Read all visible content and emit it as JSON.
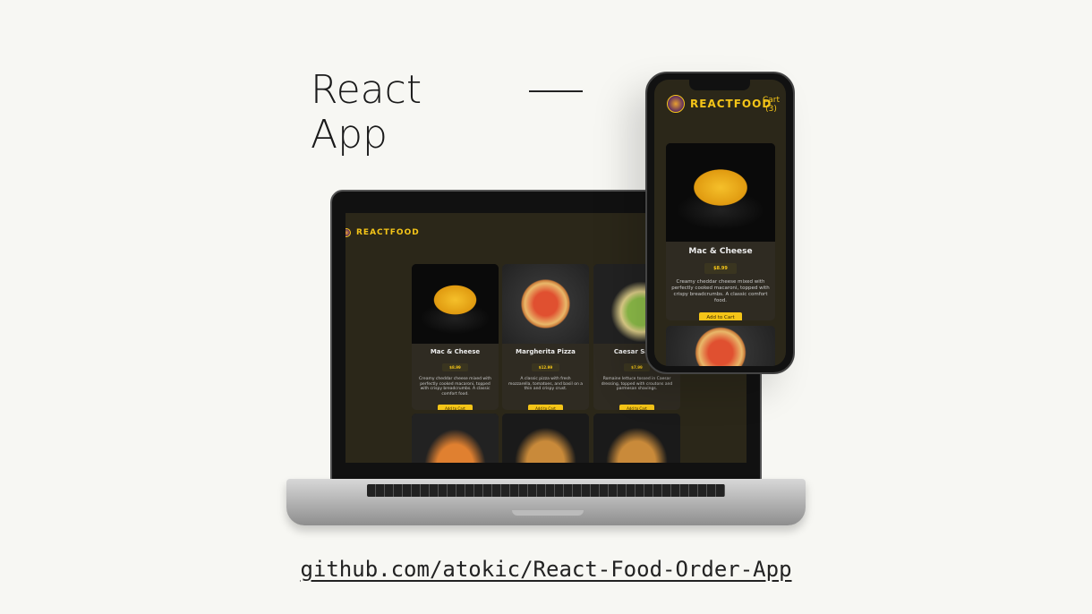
{
  "headline": {
    "line1": "React",
    "line2": "App"
  },
  "footer": {
    "url": "github.com/atokic/React-Food-Order-App"
  },
  "app": {
    "brand": "REACTFOOD",
    "cart_label": "Cart",
    "cart_count": "(3)",
    "add_to_cart": "Add to Cart",
    "meals": [
      {
        "name": "Mac & Cheese",
        "price": "$8.99",
        "description": "Creamy cheddar cheese mixed with perfectly cooked macaroni, topped with crispy breadcrumbs. A classic comfort food.",
        "image": "mac"
      },
      {
        "name": "Margherita Pizza",
        "price": "$12.99",
        "description": "A classic pizza with fresh mozzarella, tomatoes, and basil on a thin and crispy crust.",
        "image": "pizza"
      },
      {
        "name": "Caesar Salad",
        "price": "$7.99",
        "description": "Romaine lettuce tossed in Caesar dressing, topped with croutons and parmesan shavings.",
        "image": "salad"
      }
    ]
  },
  "colors": {
    "accent": "#f5c518",
    "app_bg": "#2b2719",
    "page_bg": "#f7f7f3"
  }
}
